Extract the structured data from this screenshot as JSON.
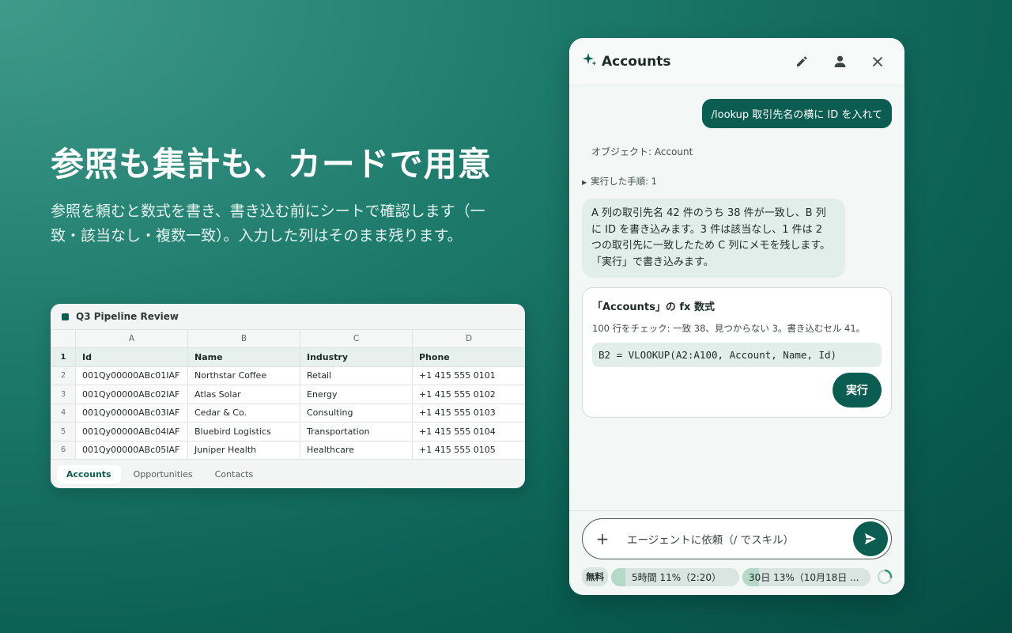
{
  "hero": {
    "title": "参照も集計も、カードで用意",
    "subtitle": "参照を頼むと数式を書き、書き込む前にシートで確認します（一致・該当なし・複数一致）。入力した列はそのまま残ります。"
  },
  "sheet": {
    "title": "Q3 Pipeline Review",
    "columns": [
      "A",
      "B",
      "C",
      "D"
    ],
    "header_row_num": "1",
    "headers": [
      "Id",
      "Name",
      "Industry",
      "Phone"
    ],
    "rows": [
      {
        "num": "2",
        "cells": [
          "001Qy00000ABc01IAF",
          "Northstar Coffee",
          "Retail",
          "+1 415 555 0101"
        ]
      },
      {
        "num": "3",
        "cells": [
          "001Qy00000ABc02IAF",
          "Atlas Solar",
          "Energy",
          "+1 415 555 0102"
        ]
      },
      {
        "num": "4",
        "cells": [
          "001Qy00000ABc03IAF",
          "Cedar & Co.",
          "Consulting",
          "+1 415 555 0103"
        ]
      },
      {
        "num": "5",
        "cells": [
          "001Qy00000ABc04IAF",
          "Bluebird Logistics",
          "Transportation",
          "+1 415 555 0104"
        ]
      },
      {
        "num": "6",
        "cells": [
          "001Qy00000ABc05IAF",
          "Juniper Health",
          "Healthcare",
          "+1 415 555 0105"
        ]
      }
    ],
    "tabs": [
      "Accounts",
      "Opportunities",
      "Contacts"
    ]
  },
  "panel": {
    "title": "Accounts",
    "icons": [
      "sparkle-icon",
      "pencil-icon",
      "user-icon",
      "close-icon"
    ],
    "user_message": "/lookup 取引先名の横に ID を入れて",
    "object_meta": "オブジェクト: Account",
    "steps_label": "実行した手順: 1",
    "bot_message": "A 列の取引先名 42 件のうち 38 件が一致し、B 列に ID を書き込みます。3 件は該当なし、1 件は 2 つの取引先に一致したため C 列にメモを残します。「実行」で書き込みます。",
    "card": {
      "title": "「Accounts」の fx 数式",
      "description": "100 行をチェック: 一致 38、見つからない 3。書き込むセル 41。",
      "formula": "B2 = VLOOKUP(A2:A100, Account, Name, Id)",
      "run_label": "実行"
    },
    "input_placeholder": "エージェントに依頼（/ でスキル）",
    "usage": {
      "plan": "無料",
      "five_hour": {
        "label": "5時間 11%（2:20）",
        "percent": 11
      },
      "thirty_day": {
        "label": "30日 13%（10月18日 ...",
        "percent": 13
      }
    },
    "colors": {
      "accent": "#0b5d52",
      "bubble": "#e2eeea"
    }
  }
}
